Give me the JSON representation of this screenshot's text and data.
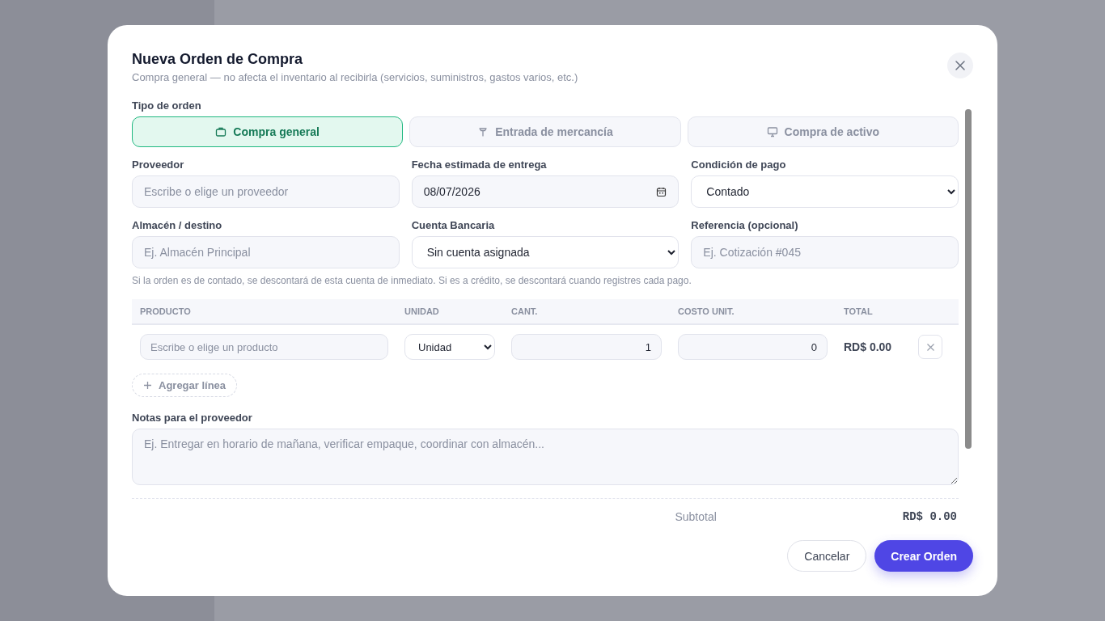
{
  "dialog": {
    "title": "Nueva Orden de Compra",
    "subtitle": "Compra general — no afecta el inventario al recibirla (servicios, suministros, gastos varios, etc.)"
  },
  "order_type": {
    "label": "Tipo de orden",
    "options": [
      {
        "label": "Compra general",
        "kind": "bag",
        "selected": true
      },
      {
        "label": "Entrada de mercancía",
        "kind": "pin",
        "selected": false
      },
      {
        "label": "Compra de activo",
        "kind": "monitor",
        "selected": false
      }
    ]
  },
  "fields": [
    {
      "label": "Proveedor",
      "kind": "input",
      "placeholder": "Escribe o elige un proveedor"
    },
    {
      "label": "Fecha estimada de entrega",
      "kind": "date",
      "value": "08/07/2026"
    },
    {
      "label": "Condición de pago",
      "kind": "select",
      "value": "Contado"
    },
    {
      "label": "Almacén / destino",
      "kind": "input",
      "placeholder": "Ej. Almacén Principal"
    },
    {
      "label": "Cuenta Bancaria",
      "kind": "select",
      "value": "Sin cuenta asignada"
    },
    {
      "label": "Referencia (opcional)",
      "kind": "input",
      "placeholder": "Ej. Cotización #045"
    }
  ],
  "hint": "Si la orden es de contado, se descontará de esta cuenta de inmediato. Si es a crédito, se descontará cuando registres cada pago.",
  "lines": {
    "columns": [
      "PRODUCTO",
      "UNIDAD",
      "CANT.",
      "COSTO UNIT.",
      "TOTAL"
    ],
    "rows": [
      {
        "product_placeholder": "Escribe o elige un producto",
        "unit": "Unidad",
        "quantity": "1",
        "unit_cost": "0",
        "total": "RD$ 0.00"
      }
    ],
    "add_line": "Agregar línea"
  },
  "notes": {
    "label": "Notas para el proveedor",
    "placeholder": "Ej. Entregar en horario de mañana, verificar empaque, coordinar con almacén..."
  },
  "summary": {
    "label": "Subtotal",
    "value": "RD$ 0.00"
  },
  "buttons": [
    {
      "label": "Cancelar",
      "kind": "secondary"
    },
    {
      "label": "Crear Orden",
      "kind": "primary"
    }
  ]
}
